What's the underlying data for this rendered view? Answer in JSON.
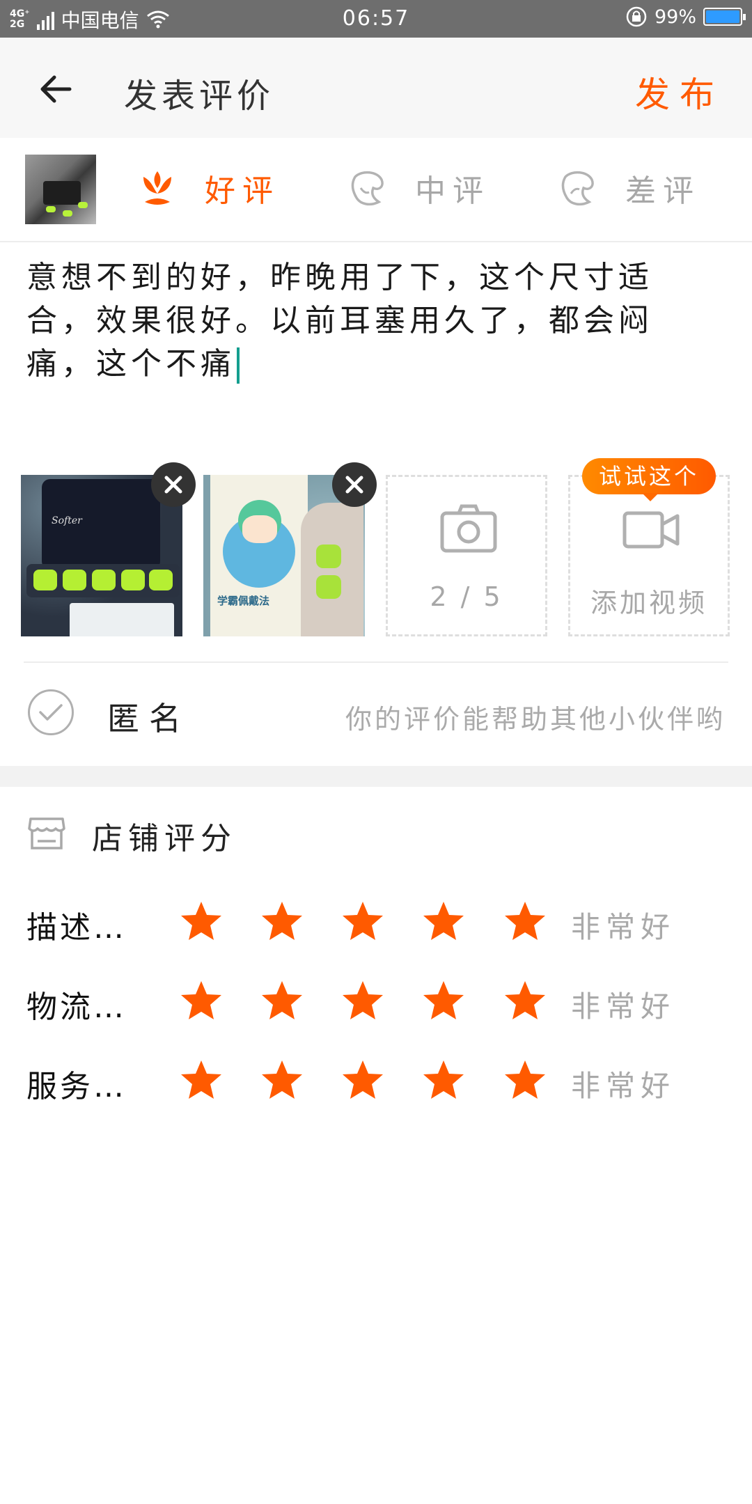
{
  "status_bar": {
    "network_top": "4G⁺",
    "network_bottom": "2G",
    "carrier": "中国电信",
    "time": "06:57",
    "battery": "99%",
    "battery_level": 0.99,
    "icons": [
      "signal-icon",
      "wifi-icon",
      "rotation-lock-icon",
      "battery-icon"
    ]
  },
  "header": {
    "back_icon": "arrow-left-icon",
    "title": "发表评价",
    "publish_label": "发布"
  },
  "rating": {
    "options": [
      {
        "label": "好评",
        "icon": "flower-icon",
        "selected": true
      },
      {
        "label": "中评",
        "icon": "face-neutral-icon",
        "selected": false
      },
      {
        "label": "差评",
        "icon": "face-sad-icon",
        "selected": false
      }
    ]
  },
  "review": {
    "text": "意想不到的好，昨晚用了下，这个尺寸适合，效果很好。以前耳塞用久了，都会闷痛，这个不痛"
  },
  "media": {
    "photo_count": "2 / 5",
    "add_video_label": "添加视频",
    "try_tip": "试试这个",
    "photo1_brand": "Softer",
    "photo2_title": "学霸佩戴法"
  },
  "anonymous": {
    "label": "匿名",
    "hint": "你的评价能帮助其他小伙伴哟",
    "checked": false
  },
  "shop_rating": {
    "title": "店铺评分",
    "rows": [
      {
        "label": "描述…",
        "stars": 5,
        "max": 5,
        "text": "非常好"
      },
      {
        "label": "物流…",
        "stars": 5,
        "max": 5,
        "text": "非常好"
      },
      {
        "label": "服务…",
        "stars": 5,
        "max": 5,
        "text": "非常好"
      }
    ]
  },
  "colors": {
    "accent": "#ff5a00",
    "muted": "#a7a7a7",
    "cursor": "#149e8f",
    "status_bar": "#6e6e6e"
  }
}
